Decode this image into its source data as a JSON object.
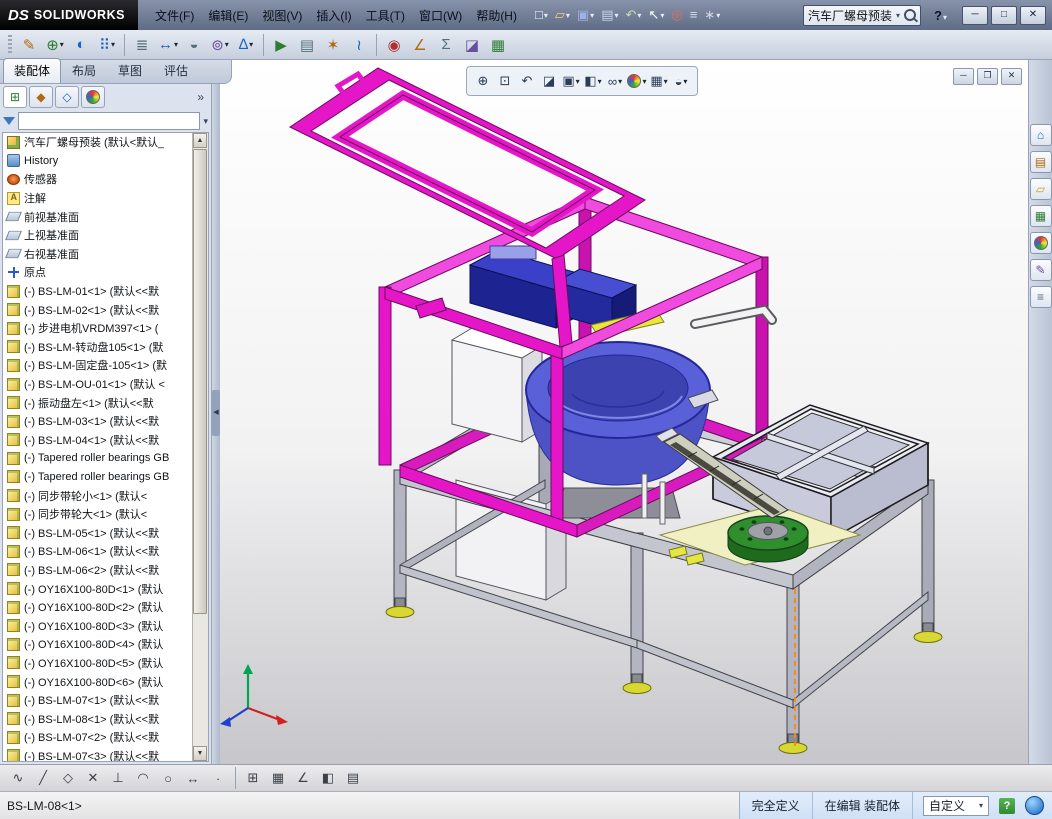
{
  "app": {
    "brand_prefix": "DS",
    "brand": "SOLIDWORKS"
  },
  "menubar": {
    "items": [
      "文件(F)",
      "编辑(E)",
      "视图(V)",
      "插入(I)",
      "工具(T)",
      "窗口(W)",
      "帮助(H)"
    ]
  },
  "quick_toolbar": {
    "icons": [
      {
        "name": "new-document",
        "glyph": "□"
      },
      {
        "name": "open-document",
        "glyph": "▱"
      },
      {
        "name": "save",
        "glyph": "▣"
      },
      {
        "name": "print",
        "glyph": "▤"
      },
      {
        "name": "undo",
        "glyph": "↶"
      },
      {
        "name": "select",
        "glyph": "↖"
      },
      {
        "name": "rebuild",
        "glyph": "◎"
      },
      {
        "name": "file-properties",
        "glyph": "≡"
      },
      {
        "name": "options",
        "glyph": "∗"
      }
    ]
  },
  "search_box": {
    "value": "汽车厂螺母预装"
  },
  "titlebar": {
    "help": "?",
    "minimize": "─",
    "maximize": "□",
    "close": "✕"
  },
  "command_toolbar": {
    "icons": [
      {
        "name": "edit-component",
        "glyph": "✎"
      },
      {
        "name": "insert-components",
        "glyph": "⊕"
      },
      {
        "name": "mate",
        "glyph": "◐"
      },
      {
        "name": "linear-component-pattern",
        "glyph": "⠿"
      },
      {
        "name": "smart-fasteners",
        "glyph": "≣"
      },
      {
        "name": "move-component",
        "glyph": "↔"
      },
      {
        "name": "show-hidden-components",
        "glyph": "◒"
      },
      {
        "name": "assembly-features",
        "glyph": "⊚"
      },
      {
        "name": "reference-geometry",
        "glyph": "∆"
      },
      {
        "name": "new-motion-study",
        "glyph": "▶"
      },
      {
        "name": "bill-of-materials",
        "glyph": "▤"
      },
      {
        "name": "exploded-view",
        "glyph": "✶"
      },
      {
        "name": "explode-line-sketch",
        "glyph": "≀"
      },
      {
        "name": "interference-detection",
        "glyph": "◉"
      },
      {
        "name": "measure",
        "glyph": "∠"
      },
      {
        "name": "mass-properties",
        "glyph": "Σ"
      },
      {
        "name": "section-properties",
        "glyph": "◪"
      },
      {
        "name": "large-assembly-mode",
        "glyph": "▦"
      }
    ]
  },
  "tabs": {
    "items": [
      {
        "label": "装配体",
        "active": true
      },
      {
        "label": "布局"
      },
      {
        "label": "草图"
      },
      {
        "label": "评估"
      }
    ]
  },
  "panel": {
    "tabs": [
      {
        "name": "featuremanager",
        "glyph": "⊞"
      },
      {
        "name": "propertymanager",
        "glyph": "◆"
      },
      {
        "name": "configurationmanager",
        "glyph": "◇"
      },
      {
        "name": "appearances",
        "glyph": ""
      }
    ],
    "chevron": "»",
    "filter_value": ""
  },
  "tree": {
    "items": [
      {
        "icon": "assembly",
        "label": "汽车厂螺母预装 (默认<默认_",
        "bold": true
      },
      {
        "icon": "history",
        "label": "History"
      },
      {
        "icon": "sensor",
        "label": "传感器"
      },
      {
        "icon": "annotation",
        "label": "注解"
      },
      {
        "icon": "plane",
        "label": "前视基准面"
      },
      {
        "icon": "plane",
        "label": "上视基准面"
      },
      {
        "icon": "plane",
        "label": "右视基准面"
      },
      {
        "icon": "origin",
        "label": "原点"
      },
      {
        "icon": "part",
        "label": "(-) BS-LM-01<1> (默认<<默"
      },
      {
        "icon": "part",
        "label": "(-) BS-LM-02<1> (默认<<默"
      },
      {
        "icon": "part",
        "label": "(-) 步进电机VRDM397<1> ("
      },
      {
        "icon": "part",
        "label": "(-) BS-LM-转动盘105<1> (默"
      },
      {
        "icon": "part",
        "label": "(-) BS-LM-固定盘-105<1> (默"
      },
      {
        "icon": "part",
        "label": "(-) BS-LM-OU-01<1> (默认 <"
      },
      {
        "icon": "part",
        "label": "(-) 振动盘左<1> (默认<<默"
      },
      {
        "icon": "part",
        "label": "(-) BS-LM-03<1> (默认<<默"
      },
      {
        "icon": "part",
        "label": "(-) BS-LM-04<1> (默认<<默"
      },
      {
        "icon": "part",
        "label": "(-) Tapered roller bearings GB"
      },
      {
        "icon": "part",
        "label": "(-) Tapered roller bearings GB"
      },
      {
        "icon": "part",
        "label": "(-) 同步带轮小<1> (默认<"
      },
      {
        "icon": "part",
        "label": "(-) 同步带轮大<1> (默认<"
      },
      {
        "icon": "part",
        "label": "(-) BS-LM-05<1> (默认<<默"
      },
      {
        "icon": "part",
        "label": "(-) BS-LM-06<1> (默认<<默"
      },
      {
        "icon": "part",
        "label": "(-) BS-LM-06<2> (默认<<默"
      },
      {
        "icon": "part",
        "label": "(-) OY16X100-80D<1> (默认"
      },
      {
        "icon": "part",
        "label": "(-) OY16X100-80D<2> (默认"
      },
      {
        "icon": "part",
        "label": "(-) OY16X100-80D<3> (默认"
      },
      {
        "icon": "part",
        "label": "(-) OY16X100-80D<4> (默认"
      },
      {
        "icon": "part",
        "label": "(-) OY16X100-80D<5> (默认"
      },
      {
        "icon": "part",
        "label": "(-) OY16X100-80D<6> (默认"
      },
      {
        "icon": "part",
        "label": "(-) BS-LM-07<1> (默认<<默"
      },
      {
        "icon": "part",
        "label": "(-) BS-LM-08<1> (默认<<默"
      },
      {
        "icon": "part",
        "label": "(-) BS-LM-07<2> (默认<<默"
      },
      {
        "icon": "part",
        "label": "(-) BS-LM-07<3> (默认<<默"
      }
    ]
  },
  "viewport": {
    "headsup": [
      {
        "name": "zoom-to-fit",
        "glyph": "⊕"
      },
      {
        "name": "zoom-to-area",
        "glyph": "⊡"
      },
      {
        "name": "previous-view",
        "glyph": "↶"
      },
      {
        "name": "section-view",
        "glyph": "◪"
      },
      {
        "name": "view-orientation",
        "glyph": "▣"
      },
      {
        "name": "display-style",
        "glyph": "◧"
      },
      {
        "name": "hide-show-items",
        "glyph": "∞"
      },
      {
        "name": "edit-appearance",
        "glyph": ""
      },
      {
        "name": "apply-scene",
        "glyph": "▦"
      },
      {
        "name": "view-settings",
        "glyph": "◒"
      }
    ],
    "doc_controls": {
      "minimize": "─",
      "restore": "❐",
      "close": "✕"
    }
  },
  "taskpane": {
    "icons": [
      {
        "name": "solidworks-resources",
        "glyph": "⌂"
      },
      {
        "name": "design-library",
        "glyph": "▤"
      },
      {
        "name": "file-explorer",
        "glyph": "▱"
      },
      {
        "name": "view-palette",
        "glyph": "▦"
      },
      {
        "name": "appearances-scenes",
        "glyph": ""
      },
      {
        "name": "custom-properties",
        "glyph": "✎"
      },
      {
        "name": "document-recovery",
        "glyph": "≡"
      }
    ]
  },
  "sketch_toolbar": {
    "icons": [
      {
        "name": "spline",
        "glyph": "∿"
      },
      {
        "name": "line",
        "glyph": "╱"
      },
      {
        "name": "polygon",
        "glyph": "◇"
      },
      {
        "name": "trim-entities",
        "glyph": "✕"
      },
      {
        "name": "perpendicular",
        "glyph": "⊥"
      },
      {
        "name": "arc",
        "glyph": "◠"
      },
      {
        "name": "circle",
        "glyph": "○"
      },
      {
        "name": "mirror-entities",
        "glyph": "↔"
      },
      {
        "name": "point",
        "glyph": "∙"
      },
      {
        "name": "grid-settings",
        "glyph": "⊞"
      },
      {
        "name": "snap-settings",
        "glyph": "▦"
      },
      {
        "name": "angle-dimension",
        "glyph": "∠"
      },
      {
        "name": "split-entities",
        "glyph": "◧"
      },
      {
        "name": "design-table",
        "glyph": "▤"
      }
    ]
  },
  "statusbar": {
    "selection": "BS-LM-08<1>",
    "defined": "完全定义",
    "editing": "在编辑 装配体",
    "custom": "自定义",
    "help": "?"
  },
  "colors": {
    "magenta": "#e516c8",
    "magenta_dark": "#8f0b7d",
    "frame_gray": "#c3c6ce",
    "bowl_blue": "#5a60d8",
    "box_navy": "#1d2390",
    "bin_light": "#e9eaf4",
    "disc_green": "#2f8f2f",
    "feet_yellow": "#d8d833",
    "highlight_orange": "#ff8800"
  }
}
